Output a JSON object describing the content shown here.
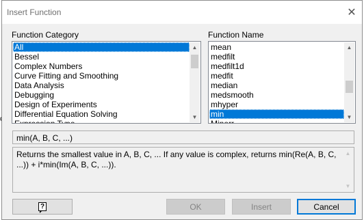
{
  "dialog": {
    "title": "Insert Function",
    "close_glyph": "✕"
  },
  "category": {
    "label": "Function Category",
    "items": [
      "All",
      "Bessel",
      "Complex Numbers",
      "Curve Fitting and Smoothing",
      "Data Analysis",
      "Debugging",
      "Design of Experiments",
      "Differential Equation Solving",
      "Expression Type"
    ],
    "selected_index": 0
  },
  "function_name": {
    "label": "Function Name",
    "items": [
      "mean",
      "medfilt",
      "medfilt1d",
      "medfit",
      "median",
      "medsmooth",
      "mhyper",
      "min",
      "Minerr"
    ],
    "selected_index": 7
  },
  "syntax": "min(A, B, C, ...)",
  "description": "Returns the smallest value in A, B, C, ... If any value is complex, returns min(Re(A, B, C, ...)) + i*min(Im(A, B, C, ...)).",
  "buttons": {
    "help_glyph": "?",
    "ok": "OK",
    "insert": "Insert",
    "cancel": "Cancel"
  },
  "colors": {
    "selection": "#0078d7",
    "dialog_bg": "#f0f0f0",
    "default_button_border": "#0078d7"
  }
}
